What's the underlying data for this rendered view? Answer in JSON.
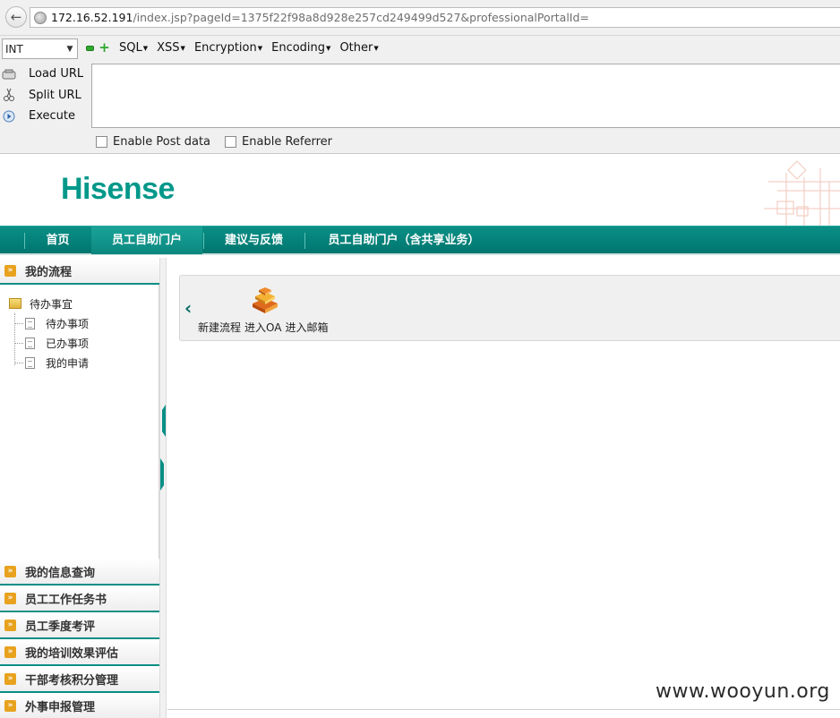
{
  "browser": {
    "url_host": "172.16.52.191",
    "url_path": "/index.jsp?pageId=1375f22f98a8d928e257cd249499d527&professionalPortalId="
  },
  "hackbar": {
    "select_value": "INT",
    "menus": [
      "SQL",
      "XSS",
      "Encryption",
      "Encoding",
      "Other"
    ],
    "actions": [
      "Load URL",
      "Split URL",
      "Execute"
    ],
    "checkboxes": [
      "Enable Post data",
      "Enable Referrer"
    ]
  },
  "header": {
    "logo_text": "Hisense",
    "brand_color": "#00988a"
  },
  "nav": {
    "items": [
      "首页",
      "员工自助门户",
      "建议与反馈",
      "员工自助门户（含共享业务）"
    ],
    "active_index": 1
  },
  "sidebar": {
    "top_section": "我的流程",
    "tree_root": "待办事宜",
    "tree_children": [
      "待办事项",
      "已办事项",
      "我的申请"
    ],
    "sections": [
      "我的信息查询",
      "员工工作任务书",
      "员工季度考评",
      "我的培训效果评估",
      "干部考核积分管理",
      "外事申报管理"
    ]
  },
  "main": {
    "links": [
      "新建流程",
      "进入OA",
      "进入邮箱"
    ]
  },
  "watermark": "www.wooyun.org"
}
